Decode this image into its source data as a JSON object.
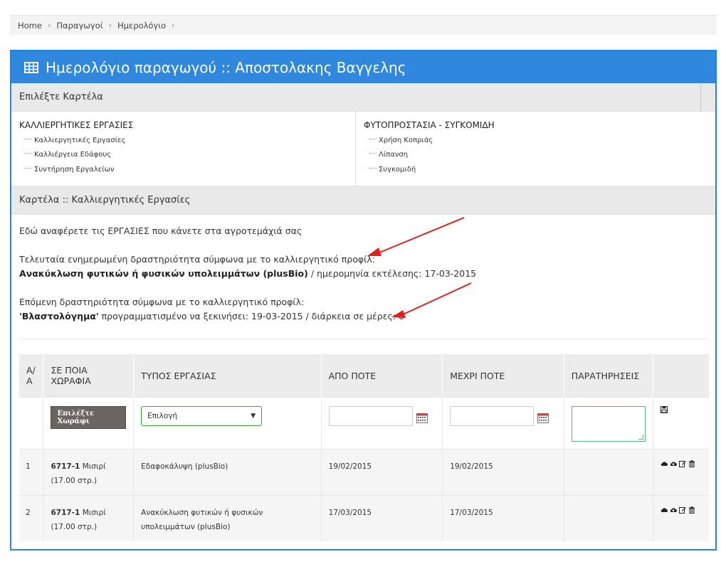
{
  "breadcrumb": [
    "Home",
    "Παραγωγοί",
    "Ημερολόγιο"
  ],
  "panel": {
    "title": "Ημερολόγιο παραγωγού :: Αποστολακης Βαγγελης",
    "select_card_label": "Επιλέξτε Καρτέλα"
  },
  "categories": [
    {
      "title": "ΚΑΛΛΙΕΡΓΗΤΙΚΕΣ ΕΡΓΑΣΙΕΣ",
      "items": [
        "Καλλιεργητικές Εργασίες",
        "Καλλιέργεια Εδάφους",
        "Συντήρηση Εργαλείων"
      ]
    },
    {
      "title": "ΦΥΤΟΠΡΟΣΤΑΣΙΑ - ΣΥΓΚΟΜΙΔΗ",
      "items": [
        "Χρήση Κοπριάς",
        "Λίπανση",
        "Συγκομιδή"
      ]
    }
  ],
  "card_section": {
    "title": "Καρτέλα :: Καλλιεργητικές Εργασίες",
    "intro": "Εδώ αναφέρετε τις ΕΡΓΑΣΙΕΣ που κάνετε στα αγροτεμάχιά σας",
    "last_label": "Τελευταία ενημερωμένη δραστηριότητα σύμφωνα με το καλλιεργητικό προφίλ:",
    "last_activity": "Ανακύκλωση φυτικών ή φυσικών υπολειμμάτων (plusBio)",
    "last_date_text": " / ημερομηνία εκτέλεσης: 17-03-2015",
    "next_label": "Επόμενη δραστηριότητα σύμφωνα με το καλλιεργητικό προφίλ:",
    "next_activity": "'Βλαστολόγημα'",
    "next_info_text": " προγραμματισμένο να ξεκινήσει: 19-03-2015 / διάρκεια σε μέρες: 6"
  },
  "table": {
    "headers": {
      "aa_1": "Α/",
      "aa_2": "Α",
      "field_1": "ΣΕ ΠΟΙΑ",
      "field_2": "ΧΩΡΑΦΙΑ",
      "type": "ΤΥΠΟΣ ΕΡΓΑΣΙΑΣ",
      "from": "ΑΠΟ ΠΟΤΕ",
      "to": "ΜΕΧΡΙ ΠΟΤΕ",
      "notes": "ΠΑΡΑΤΗΡΗΣΕΙΣ"
    },
    "entry": {
      "field_button": "Επιλέξτε Χωράφι",
      "type_select": "Επιλογή",
      "from_value": "",
      "to_value": "",
      "notes_value": ""
    },
    "rows": [
      {
        "num": "1",
        "field_code": "6717-1",
        "field_desc": " Μισιρί (17.00 στρ.)",
        "type": "Εδαφοκάλυψη (plusBio)",
        "from": "19/02/2015",
        "to": "19/02/2015",
        "notes": ""
      },
      {
        "num": "2",
        "field_code": "6717-1",
        "field_desc": " Μισιρί (17.00 στρ.)",
        "type": "Ανακύκλωση φυτικών ή φυσικών υπολειμμάτων (plusBio)",
        "from": "17/03/2015",
        "to": "17/03/2015",
        "notes": ""
      }
    ]
  },
  "colors": {
    "header_blue": "#2f88de",
    "arrow_red": "#e02020",
    "field_button": "#6b6562"
  },
  "icons": {
    "title": "table-grid-icon",
    "save": "save-icon",
    "row_actions": [
      "cloud-icon",
      "cloud-upload-icon",
      "edit-icon",
      "trash-icon"
    ]
  }
}
